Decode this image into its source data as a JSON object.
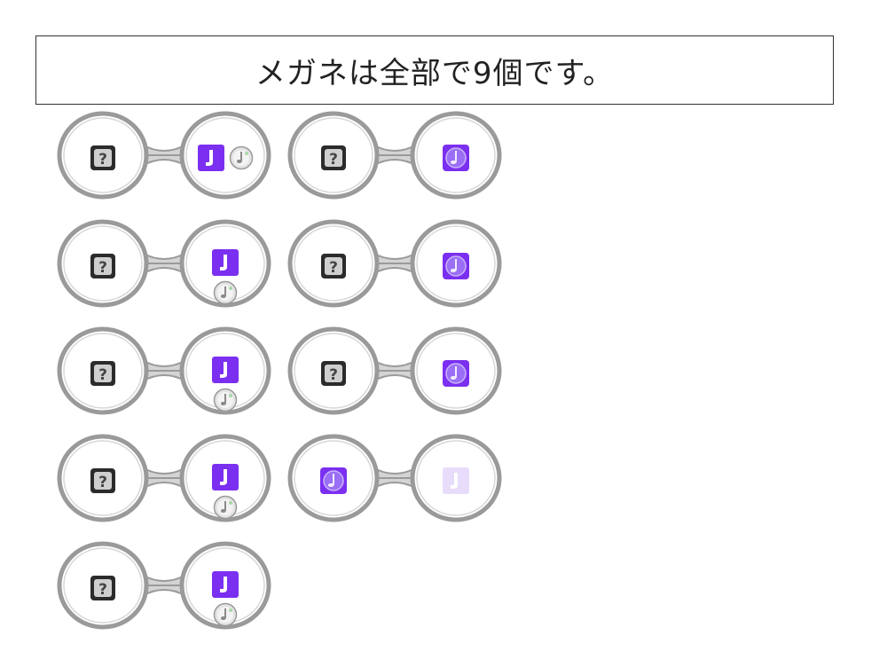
{
  "title": "メガネは全部で9個です。",
  "colors": {
    "frame": "#9a9a9a",
    "tile_purple": "#7b2ff0",
    "unknown_box": "#2b2b2b",
    "faded_purple": "#e8dcfb"
  },
  "glasses": [
    {
      "left": [
        "unknown-box-icon"
      ],
      "right": [
        "note-tile-icon",
        "note-disc-icon"
      ],
      "right_layout": "row"
    },
    {
      "left": [
        "unknown-box-icon"
      ],
      "right": [
        "note-tile-icon",
        "note-disc-icon"
      ],
      "right_layout": "column"
    },
    {
      "left": [
        "unknown-box-icon"
      ],
      "right": [
        "note-tile-icon",
        "note-disc-icon"
      ],
      "right_layout": "column"
    },
    {
      "left": [
        "unknown-box-icon"
      ],
      "right": [
        "note-tile-icon",
        "note-disc-icon"
      ],
      "right_layout": "column"
    },
    {
      "left": [
        "unknown-box-icon"
      ],
      "right": [
        "note-tile-icon",
        "note-disc-icon"
      ],
      "right_layout": "column"
    },
    {
      "left": [
        "unknown-box-icon"
      ],
      "right": [
        "note-disc-tile-icon"
      ],
      "right_layout": "row"
    },
    {
      "left": [
        "unknown-box-icon"
      ],
      "right": [
        "note-disc-tile-icon"
      ],
      "right_layout": "row"
    },
    {
      "left": [
        "unknown-box-icon"
      ],
      "right": [
        "note-disc-tile-icon"
      ],
      "right_layout": "row"
    },
    {
      "left": [
        "note-disc-tile-icon"
      ],
      "right": [
        "faded-note-tile-icon"
      ],
      "right_layout": "row"
    }
  ]
}
